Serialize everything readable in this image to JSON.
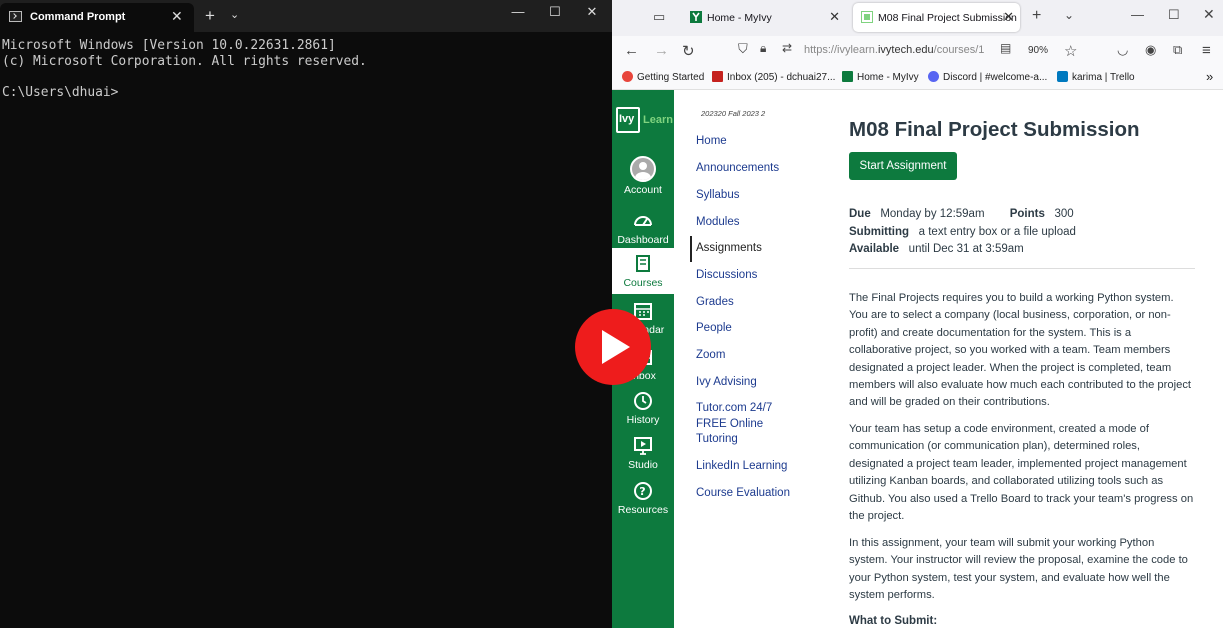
{
  "cmd": {
    "tab_title": "Command Prompt",
    "lines": [
      "Microsoft Windows [Version 10.0.22631.2861]",
      "(c) Microsoft Corporation. All rights reserved.",
      "",
      "C:\\Users\\dhuai>"
    ]
  },
  "browser": {
    "tabs": [
      {
        "title": "Home - MyIvy"
      },
      {
        "title": "M08 Final Project Submission"
      }
    ],
    "url_prefix": "https://ivylearn.",
    "url_domain": "ivytech.edu",
    "url_suffix": "/courses/1",
    "zoom": "90%",
    "bookmarks": [
      {
        "label": "Getting Started",
        "color": "#e8453c"
      },
      {
        "label": "Inbox (205) - dchuai27...",
        "color": "#c5221f"
      },
      {
        "label": "Home - MyIvy",
        "color": "#0d7a3e"
      },
      {
        "label": "Discord | #welcome-a...",
        "color": "#5865f2"
      },
      {
        "label": "karima | Trello",
        "color": "#0079bf"
      }
    ]
  },
  "global_nav": {
    "logo_box": "Ivy",
    "logo_word": "Learn",
    "items": [
      {
        "label": "Account"
      },
      {
        "label": "Dashboard"
      },
      {
        "label": "Courses"
      },
      {
        "label": "Calendar"
      },
      {
        "label": "Inbox"
      },
      {
        "label": "History"
      },
      {
        "label": "Studio"
      },
      {
        "label": "Resources"
      }
    ]
  },
  "course_nav": {
    "term": "202320 Fall 2023 2",
    "items": [
      {
        "label": "Home"
      },
      {
        "label": "Announcements"
      },
      {
        "label": "Syllabus"
      },
      {
        "label": "Modules"
      },
      {
        "label": "Assignments"
      },
      {
        "label": "Discussions"
      },
      {
        "label": "Grades"
      },
      {
        "label": "People"
      },
      {
        "label": "Zoom"
      },
      {
        "label": "Ivy Advising"
      },
      {
        "label": "Tutor.com 24/7 FREE Online Tutoring"
      },
      {
        "label": "LinkedIn Learning"
      },
      {
        "label": "Course Evaluation"
      }
    ]
  },
  "assignment": {
    "title": "M08 Final Project Submission",
    "start_button": "Start Assignment",
    "due_label": "Due",
    "due_value": "Monday by 12:59am",
    "points_label": "Points",
    "points_value": "300",
    "submitting_label": "Submitting",
    "submitting_value": "a text entry box or a file upload",
    "available_label": "Available",
    "available_value": "until Dec 31 at 3:59am",
    "paragraphs": [
      "The Final Projects requires you to build a working Python system. You are to select a company (local business, corporation, or non-profit) and create documentation for the system. This is a collaborative project, so you worked with a team. Team members designated a project leader. When the project is completed, team members will also evaluate how much each contributed to the project and will be graded on their contributions.",
      "Your team has setup a code environment, created a mode of communication (or communication plan), determined roles, designated a project team leader, implemented project management utilizing Kanban boards, and collaborated utilizing tools such as Github. You also used a Trello Board to track your team's progress on the project.",
      "In this assignment, your team will submit your working Python system. Your instructor will review the proposal, examine the code to your Python system, test your system, and evaluate how well the system performs."
    ],
    "what_to_submit": "What to Submit:"
  },
  "colors": {
    "canvas_green": "#0d7a3e",
    "link_blue": "#1d3b8f",
    "play_red": "#ee1c1c"
  }
}
